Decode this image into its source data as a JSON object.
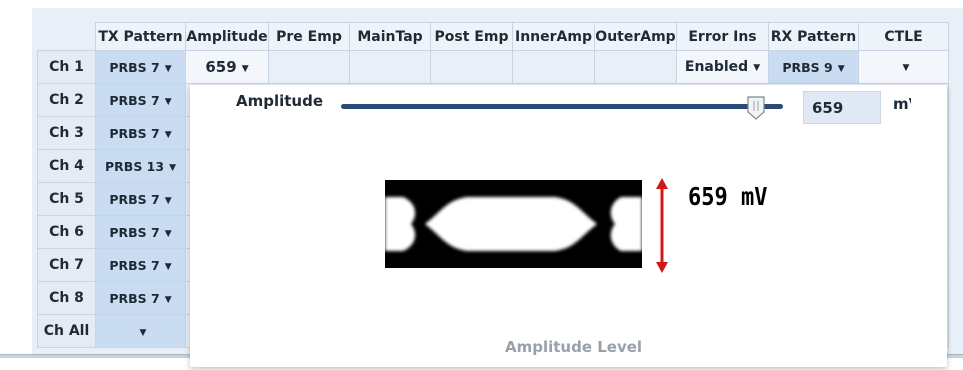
{
  "columns": [
    "TX Pattern",
    "Amplitude",
    "Pre Emp",
    "MainTap",
    "Post Emp",
    "InnerAmp",
    "OuterAmp",
    "Error Ins",
    "RX Pattern",
    "CTLE"
  ],
  "row1": {
    "label": "Ch 1",
    "tx_pattern": "PRBS 7",
    "amplitude": "659",
    "error_ins": "Enabled",
    "rx_pattern": "PRBS 9"
  },
  "rows": [
    {
      "label": "Ch 2",
      "tx_pattern": "PRBS 7"
    },
    {
      "label": "Ch 3",
      "tx_pattern": "PRBS 7"
    },
    {
      "label": "Ch 4",
      "tx_pattern": "PRBS 13"
    },
    {
      "label": "Ch 5",
      "tx_pattern": "PRBS 7"
    },
    {
      "label": "Ch 6",
      "tx_pattern": "PRBS 7"
    },
    {
      "label": "Ch 7",
      "tx_pattern": "PRBS 7"
    },
    {
      "label": "Ch 8",
      "tx_pattern": "PRBS 7"
    },
    {
      "label": "Ch All",
      "tx_pattern": ""
    }
  ],
  "popup": {
    "slider_label": "Amplitude",
    "slider_fraction": 0.94,
    "value": "659",
    "unit": "mV",
    "eye_readout": "659  mV",
    "title": "Amplitude Level"
  },
  "colors": {
    "slider_track": "#2b4a78",
    "arrow": "#d01818",
    "eye": "#000000"
  },
  "icons": {
    "dropdown": "caret-down-icon",
    "slider_thumb": "slider-thumb-icon",
    "arrow": "double-arrow-icon"
  }
}
